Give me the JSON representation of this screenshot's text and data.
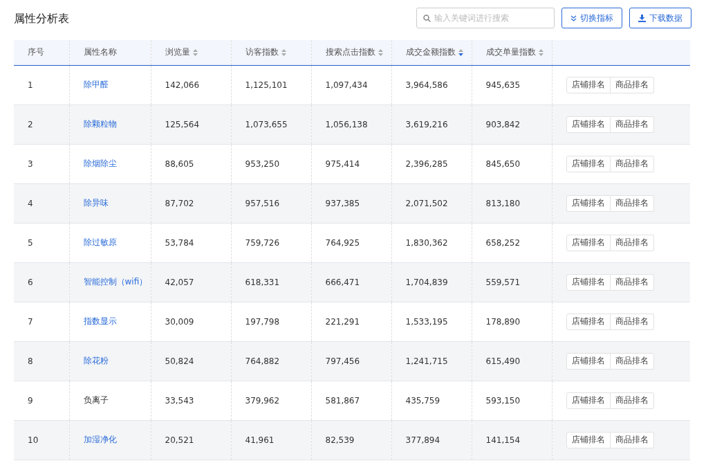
{
  "title": "属性分析表",
  "search": {
    "placeholder": "输入关键词进行搜索"
  },
  "buttons": [
    {
      "label": "切换指标",
      "kind": "switch"
    },
    {
      "label": "下载数据",
      "kind": "download"
    }
  ],
  "table": {
    "columns": [
      {
        "label": "序号",
        "kind": "plain"
      },
      {
        "label": "属性名称",
        "kind": "plain"
      },
      {
        "label": "浏览量",
        "kind": "sortable",
        "sorted": false
      },
      {
        "label": "访客指数",
        "kind": "sortable",
        "sorted": false
      },
      {
        "label": "搜索点击指数",
        "kind": "sortable",
        "sorted": false
      },
      {
        "label": "成交金额指数",
        "kind": "sortable",
        "sorted": true
      },
      {
        "label": "成交单量指数",
        "kind": "sortable",
        "sorted": false
      },
      {
        "kind": "plain"
      }
    ],
    "rows": [
      {
        "index": "1",
        "name": "除甲醛",
        "link": true,
        "values": [
          "142,066",
          "1,125,101",
          "1,097,434",
          "3,964,586",
          "945,635"
        ],
        "actions": [
          "店铺排名",
          "商品排名"
        ]
      },
      {
        "index": "2",
        "name": "除颗粒物",
        "link": true,
        "values": [
          "125,564",
          "1,073,655",
          "1,056,138",
          "3,619,216",
          "903,842"
        ],
        "actions": [
          "店铺排名",
          "商品排名"
        ]
      },
      {
        "index": "3",
        "name": "除烟除尘",
        "link": true,
        "values": [
          "88,605",
          "953,250",
          "975,414",
          "2,396,285",
          "845,650"
        ],
        "actions": [
          "店铺排名",
          "商品排名"
        ]
      },
      {
        "index": "4",
        "name": "除异味",
        "link": true,
        "values": [
          "87,702",
          "957,516",
          "937,385",
          "2,071,502",
          "813,180"
        ],
        "actions": [
          "店铺排名",
          "商品排名"
        ]
      },
      {
        "index": "5",
        "name": "除过敏原",
        "link": true,
        "values": [
          "53,784",
          "759,726",
          "764,925",
          "1,830,362",
          "658,252"
        ],
        "actions": [
          "店铺排名",
          "商品排名"
        ]
      },
      {
        "index": "6",
        "name": "智能控制（wifi）",
        "link": true,
        "values": [
          "42,057",
          "618,331",
          "666,471",
          "1,704,839",
          "559,571"
        ],
        "actions": [
          "店铺排名",
          "商品排名"
        ]
      },
      {
        "index": "7",
        "name": "指数显示",
        "link": true,
        "values": [
          "30,009",
          "197,798",
          "221,291",
          "1,533,195",
          "178,890"
        ],
        "actions": [
          "店铺排名",
          "商品排名"
        ]
      },
      {
        "index": "8",
        "name": "除花粉",
        "link": true,
        "values": [
          "50,824",
          "764,882",
          "797,456",
          "1,241,715",
          "615,490"
        ],
        "actions": [
          "店铺排名",
          "商品排名"
        ]
      },
      {
        "index": "9",
        "name": "负离子",
        "link": false,
        "values": [
          "33,543",
          "379,962",
          "581,867",
          "435,759",
          "593,150"
        ],
        "actions": [
          "店铺排名",
          "商品排名"
        ]
      },
      {
        "index": "10",
        "name": "加湿净化",
        "link": true,
        "values": [
          "20,521",
          "41,961",
          "82,539",
          "377,894",
          "141,154"
        ],
        "actions": [
          "店铺排名",
          "商品排名"
        ]
      }
    ]
  }
}
